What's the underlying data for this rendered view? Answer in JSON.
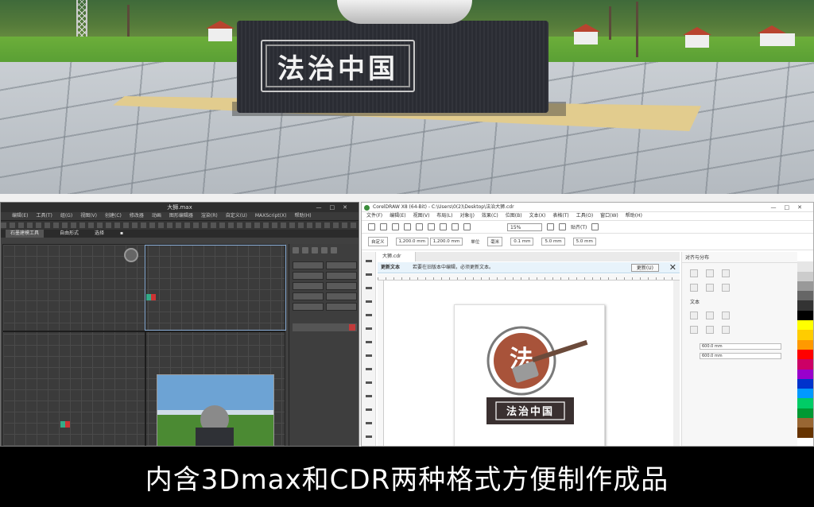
{
  "scene": {
    "plaque_text": "法治中国"
  },
  "max_window": {
    "title": "大狮.max",
    "window_controls": [
      "—",
      "□",
      "✕"
    ],
    "menu": [
      "编辑(E)",
      "工具(T)",
      "组(G)",
      "视图(V)",
      "创建(C)",
      "修改器",
      "动画",
      "图形编辑器",
      "渲染(R)",
      "自定义(U)",
      "MAXScript(X)",
      "帮助(H)"
    ],
    "ribbon": [
      "石墨建模工具",
      "自由形式",
      "选择",
      "▪"
    ]
  },
  "cdr_window": {
    "title": "CorelDRAW X8 (64-Bit) - C:\\Users\\0(2)\\Desktop\\法治大狮.cdr",
    "window_controls": [
      "—",
      "□",
      "✕"
    ],
    "menu": [
      "文件(F)",
      "编辑(E)",
      "视图(V)",
      "布局(L)",
      "对象(J)",
      "效果(C)",
      "位图(B)",
      "文本(X)",
      "表格(T)",
      "工具(O)",
      "窗口(W)",
      "帮助(H)"
    ],
    "zoom": "15%",
    "snap_label": "贴齐(T)",
    "prop_preset": "自定义",
    "width_value": "1,200.0 mm",
    "height_value": "1,200.0 mm",
    "units_label": "单位",
    "units_value": "毫米",
    "nudge_value": "0.1 mm",
    "dup_x": "5.0 mm",
    "dup_y": "5.0 mm",
    "doc_tab": "大狮.cdr",
    "notice_title": "更新文本",
    "notice_body": "若要在旧版本中编辑，必须更新文本。",
    "notice_button": "更新(U)",
    "dock_title": "对齐与分布",
    "dock_text_label": "文本",
    "dock_x": "600.0 mm",
    "dock_y": "600.0 mm",
    "logo_char": "法",
    "logo_base_text": "法治中国",
    "palette_colors": [
      "#ffffff",
      "#e6e6e6",
      "#cccccc",
      "#999999",
      "#666666",
      "#333333",
      "#000000",
      "#ffff00",
      "#ffcc00",
      "#ff9900",
      "#ff0000",
      "#cc0066",
      "#9900cc",
      "#0033cc",
      "#0099ff",
      "#00cc66",
      "#009933",
      "#996633",
      "#663300",
      "#ffffff"
    ]
  },
  "caption": "内含3Dmax和CDR两种格式方便制作成品"
}
